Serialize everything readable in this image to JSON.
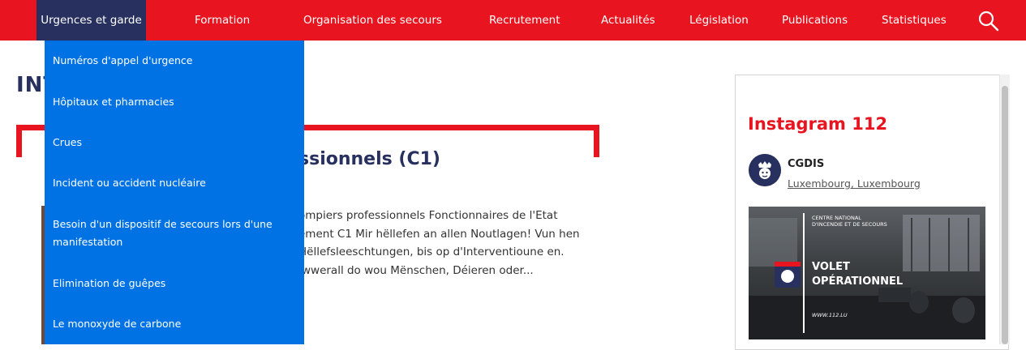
{
  "nav": {
    "items": [
      {
        "label": "Urgences et garde",
        "active": true
      },
      {
        "label": "Formation"
      },
      {
        "label": "Organisation des secours"
      },
      {
        "label": "Recrutement"
      },
      {
        "label": "Actualités"
      },
      {
        "label": "Législation"
      },
      {
        "label": "Publications"
      },
      {
        "label": "Statistiques"
      }
    ],
    "search_icon": "search-icon"
  },
  "dropdown": {
    "items": [
      "Numéros d'appel d'urgence",
      "Hôpitaux et pharmacies",
      "Crues",
      "Incident ou accident nucléaire",
      "Besoin d'un dispositif de secours lors d'une manifestation",
      "Elimination de guêpes",
      "Le monoxyde de carbone"
    ]
  },
  "main": {
    "heading": "INT",
    "article": {
      "title": "ssionnels (C1)",
      "text": "ompiers professionnels Fonctionnaires de l'Etat ement C1 Mir hëllefen an allen Noutlagen! Vun hen Hëllefsleeschtungen, bis op d'Interventioune en. Iwwerall do wou Mënschen, Déieren oder..."
    }
  },
  "instagram": {
    "title": "Instagram 112",
    "account_name": "CGDIS",
    "location": "Luxembourg, Luxembourg",
    "post": {
      "org_line1": "CENTRE NATIONAL",
      "org_line2": "D'INCENDIE ET DE SECOURS",
      "headline_line1": "VOLET",
      "headline_line2": "OPÉRATIONNEL",
      "url": "WWW.112.LU"
    }
  },
  "colors": {
    "brand_red": "#e8141f",
    "navy": "#27305e",
    "dropdown_blue": "#0072e3"
  }
}
